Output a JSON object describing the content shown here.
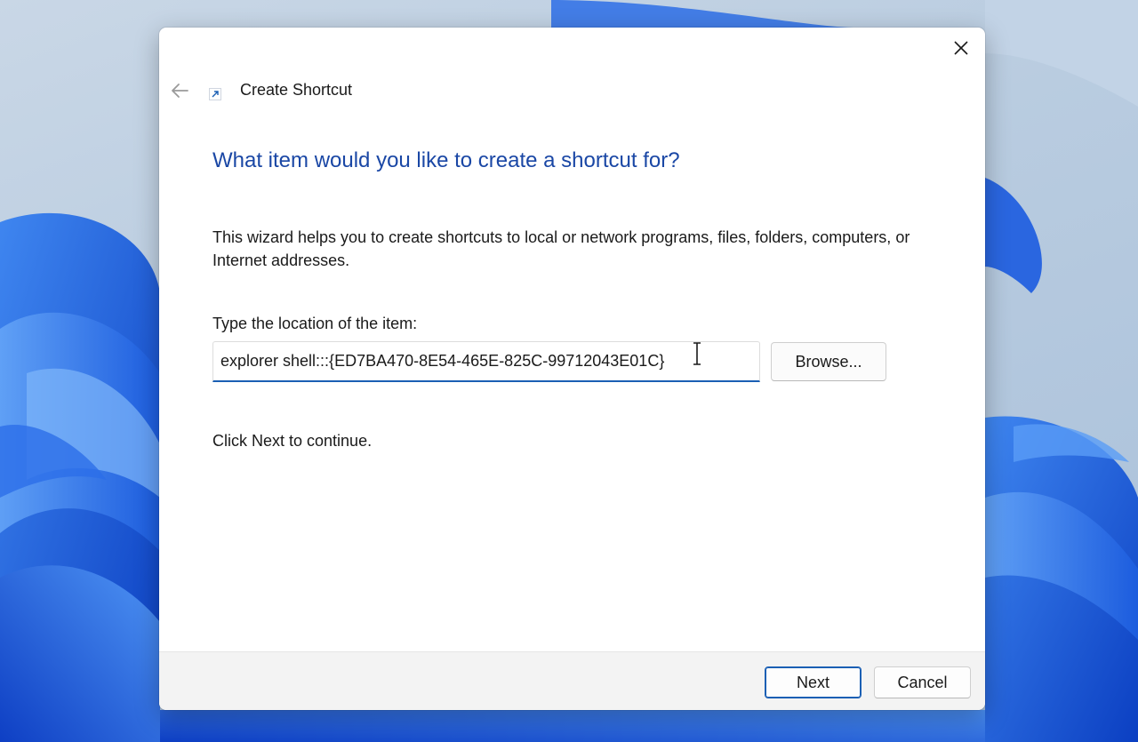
{
  "window": {
    "title": "Create Shortcut",
    "close_icon": "close-icon",
    "back_icon": "back-arrow-icon",
    "shortcut_icon": "shortcut-arrow-icon"
  },
  "main": {
    "heading": "What item would you like to create a shortcut for?",
    "description": "This wizard helps you to create shortcuts to local or network programs, files, folders, computers, or Internet addresses.",
    "location_label": "Type the location of the item:",
    "location_value": "explorer shell:::{ED7BA470-8E54-465E-825C-99712043E01C}",
    "browse_label": "Browse...",
    "continue_text": "Click Next to continue."
  },
  "footer": {
    "next_label": "Next",
    "cancel_label": "Cancel"
  },
  "colors": {
    "heading": "#1a47a5",
    "accent": "#1a5fb4",
    "footer_bg": "#f3f3f3"
  }
}
